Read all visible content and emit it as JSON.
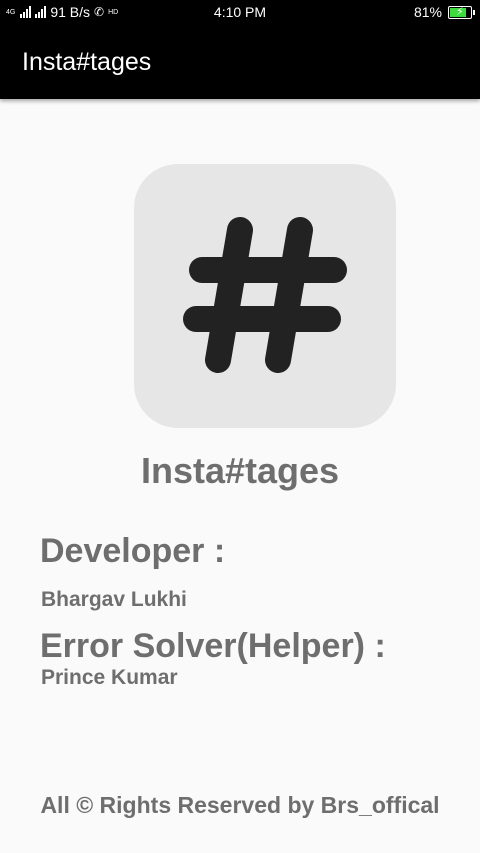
{
  "status_bar": {
    "network_speed": "91 B/s",
    "hd_label": "HD",
    "time": "4:10 PM",
    "battery_percent": "81%",
    "battery_level": 0.81,
    "battery_color": "#3ddc3d"
  },
  "app_bar": {
    "title": "Insta#tages"
  },
  "main": {
    "logo_icon": "hashtag-icon",
    "app_name": "Insta#tages",
    "developer_label": "Developer :",
    "developer_name": "Bhargav Lukhi",
    "helper_label": "Error Solver(Helper) :",
    "helper_name": "Prince Kumar",
    "footer": "All © Rights Reserved by Brs_offical"
  },
  "colors": {
    "text_gray": "#6e6e6e",
    "app_bar_bg": "#000000",
    "logo_bg": "#e6e6e6",
    "logo_glyph": "#222222"
  }
}
